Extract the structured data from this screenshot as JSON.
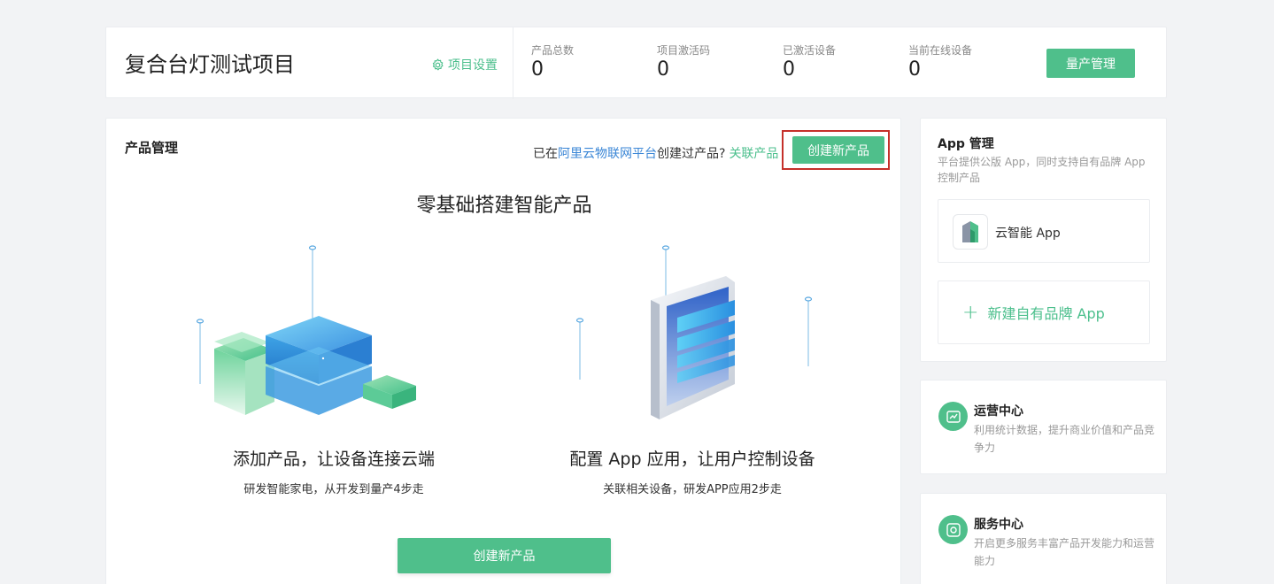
{
  "header": {
    "project_title": "复合台灯测试项目",
    "settings_label": "项目设置",
    "stats": [
      {
        "label": "产品总数",
        "value": "0"
      },
      {
        "label": "项目激活码",
        "value": "0"
      },
      {
        "label": "已激活设备",
        "value": "0"
      },
      {
        "label": "当前在线设备",
        "value": "0"
      }
    ],
    "mass_production_button": "量产管理"
  },
  "product_management": {
    "title": "产品管理",
    "hint_prefix": "已在",
    "hint_link": "阿里云物联网平台",
    "hint_suffix": "创建过产品?",
    "link_product": "关联产品",
    "create_button": "创建新产品",
    "slogan": "零基础搭建智能产品",
    "features": [
      {
        "title": "添加产品，让设备连接云端",
        "subtitle": "研发智能家电，从开发到量产4步走"
      },
      {
        "title": "配置 App 应用，让用户控制设备",
        "subtitle": "关联相关设备，研发APP应用2步走"
      }
    ],
    "create_button_bottom": "创建新产品"
  },
  "app_management": {
    "title": "App 管理",
    "description": "平台提供公版 App，同时支持自有品牌 App 控制产品",
    "app_name": "云智能 App",
    "new_app_label": "新建自有品牌 App"
  },
  "operations_center": {
    "title": "运营中心",
    "description": "利用统计数据，提升商业价值和产品竞争力"
  },
  "service_center": {
    "title": "服务中心",
    "description": "开启更多服务丰富产品开发能力和运营能力"
  },
  "colors": {
    "accent_green": "#4fbf8b",
    "link_blue": "#3a86d6",
    "highlight_red": "#c5302a"
  }
}
